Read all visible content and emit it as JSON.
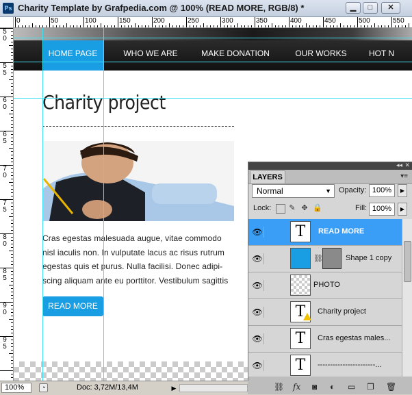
{
  "window": {
    "app_icon": "Ps",
    "title": "Charity Template by Grafpedia.com @ 100% (READ MORE, RGB/8) *",
    "controls": [
      "minimize-icon",
      "restore-icon",
      "close-icon"
    ]
  },
  "ruler": {
    "top_labels": [
      "0",
      "50",
      "100",
      "150",
      "200",
      "250",
      "300",
      "350",
      "400",
      "450",
      "500",
      "550"
    ],
    "left_labels": [
      "5 0",
      "5 5",
      "6 0",
      "6 5",
      "7 0",
      "7 5",
      "8 0",
      "8 5",
      "9 0",
      "9 5"
    ]
  },
  "document": {
    "nav": [
      "HOME PAGE",
      "WHO WE ARE",
      "MAKE DONATION",
      "OUR WORKS",
      "HOT N"
    ],
    "heading": "Charity project",
    "body_lines": [
      "Cras egestas malesuada augue, vitae commodo",
      "nisl iaculis non. In vulputate lacus ac risus rutrum",
      "egestas quis et purus. Nulla facilisi. Donec adipi-",
      "scing aliquam ante eu porttitor. Vestibulum sagittis"
    ],
    "button": "READ MORE"
  },
  "layers_panel": {
    "tab": "LAYERS",
    "blend_mode": "Normal",
    "opacity_label": "Opacity:",
    "opacity_value": "100%",
    "lock_label": "Lock:",
    "fill_label": "Fill:",
    "fill_value": "100%",
    "layers": [
      {
        "name": "READ MORE",
        "type": "text",
        "selected": true
      },
      {
        "name": "Shape 1 copy",
        "type": "shape",
        "selected": false
      },
      {
        "name": "PHOTO",
        "type": "raster",
        "selected": false
      },
      {
        "name": "Charity project",
        "type": "text-warning",
        "selected": false
      },
      {
        "name": "Cras egestas males...",
        "type": "text",
        "selected": false
      },
      {
        "name": "-----------------------...",
        "type": "text",
        "selected": false
      }
    ],
    "bottom_icons": [
      "link-icon",
      "fx-icon",
      "mask-icon",
      "adjustment-icon",
      "folder-icon",
      "new-layer-icon",
      "trash-icon"
    ]
  },
  "statusbar": {
    "zoom": "100%",
    "doc_info": "Doc: 3,72M/13,4M"
  }
}
